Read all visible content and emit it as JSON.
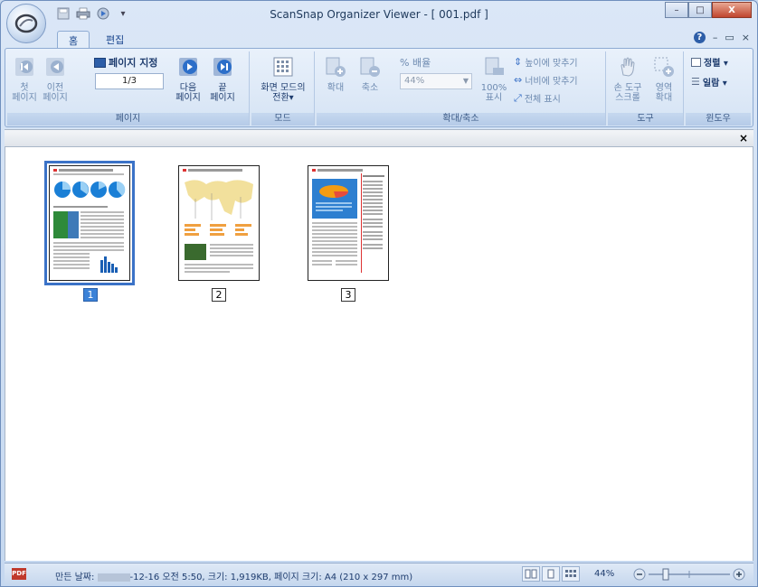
{
  "window": {
    "title": "ScanSnap Organizer Viewer - [ 001.pdf ]",
    "minimize": "–",
    "maximize": "□",
    "close": "X"
  },
  "tabs": [
    {
      "label": "홈",
      "active": true
    },
    {
      "label": "편집",
      "active": false
    }
  ],
  "tab_right": {
    "help": "?",
    "minimize": "–",
    "restore": "▭",
    "close": "×"
  },
  "ribbon": {
    "page_group": {
      "label": "페이지",
      "first": "첫\n페이지",
      "prev": "이전\n페이지",
      "goto": "페이지 지정",
      "page_value": "1/3",
      "next": "다음\n페이지",
      "last": "끝\n페이지"
    },
    "mode_group": {
      "label": "모드",
      "switch": "화면 모드의\n전환▾"
    },
    "zoom_group": {
      "label": "확대/축소",
      "zoom_in": "확대",
      "zoom_out": "축소",
      "percent_label": "% 배율",
      "percent_value": "44%",
      "actual_size": "100%\n표시",
      "fit_height": "높이에 맞추기",
      "fit_width": "너비에 맞추기",
      "full_view": "전체 표시"
    },
    "tools_group": {
      "label": "도구",
      "hand": "손 도구\n스크롤",
      "area": "영역\n확대"
    },
    "window_group": {
      "label": "윈도우",
      "arrange": "정렬 ▾",
      "list": "일람 ▾"
    }
  },
  "thumbnails": [
    {
      "number": "1",
      "selected": true
    },
    {
      "number": "2",
      "selected": false
    },
    {
      "number": "3",
      "selected": false
    }
  ],
  "status": {
    "pdf_badge": "PDF",
    "created_label": "만든 날짜:",
    "info_tail": "-12-16 오전 5:50, 크기: 1,919KB, 페이지 크기: A4 (210 x 297 mm)",
    "zoom": "44%"
  },
  "colors": {
    "accent": "#3b72c7",
    "ribbon_bg": "#dbe7f7",
    "selection": "#3b82d8"
  }
}
